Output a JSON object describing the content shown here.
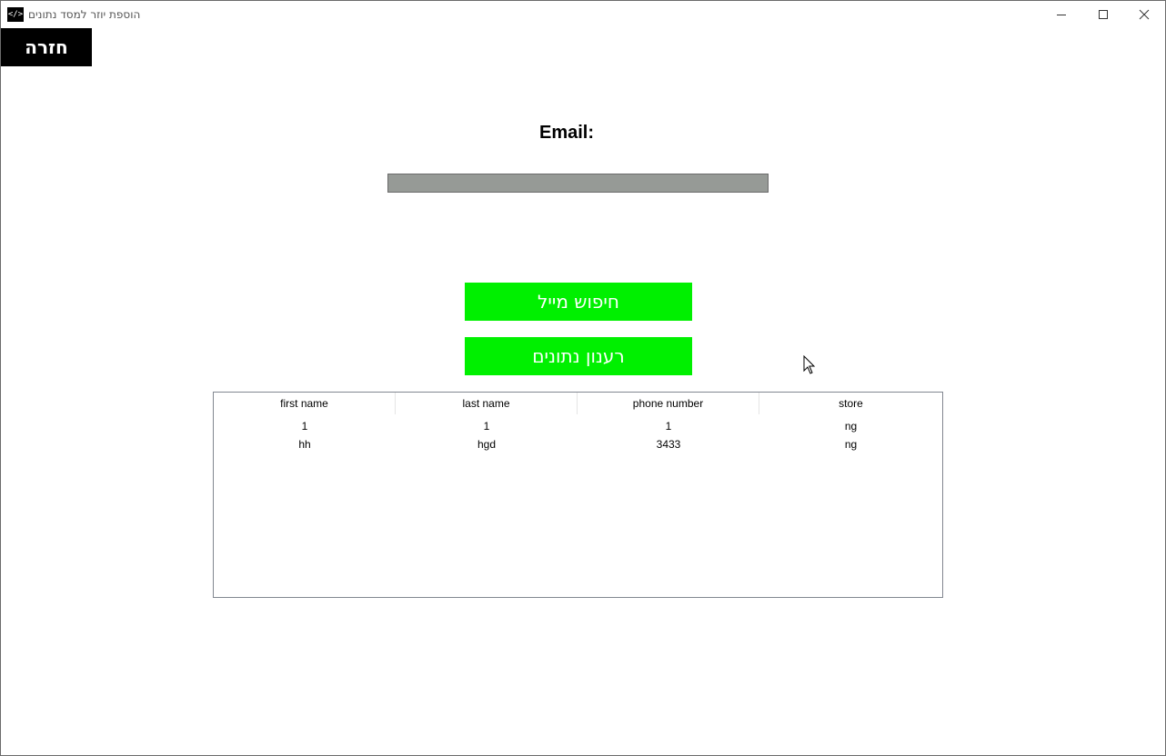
{
  "window": {
    "title": "הוספת יוזר למסד נתונים",
    "app_icon": "</>"
  },
  "toolbar": {
    "back_label": "חזרה"
  },
  "form": {
    "email_label": "Email:",
    "email_value": ""
  },
  "buttons": {
    "search_label": "חיפוש מייל",
    "refresh_label": "רענון נתונים"
  },
  "table": {
    "columns": [
      "first name",
      "last name",
      "phone number",
      "store"
    ],
    "rows": [
      [
        "1",
        "1",
        "1",
        "ng"
      ],
      [
        "hh",
        "hgd",
        "3433",
        "ng"
      ]
    ]
  },
  "colors": {
    "button_green": "#00f000",
    "input_gray": "#969a96",
    "back_black": "#000000"
  }
}
